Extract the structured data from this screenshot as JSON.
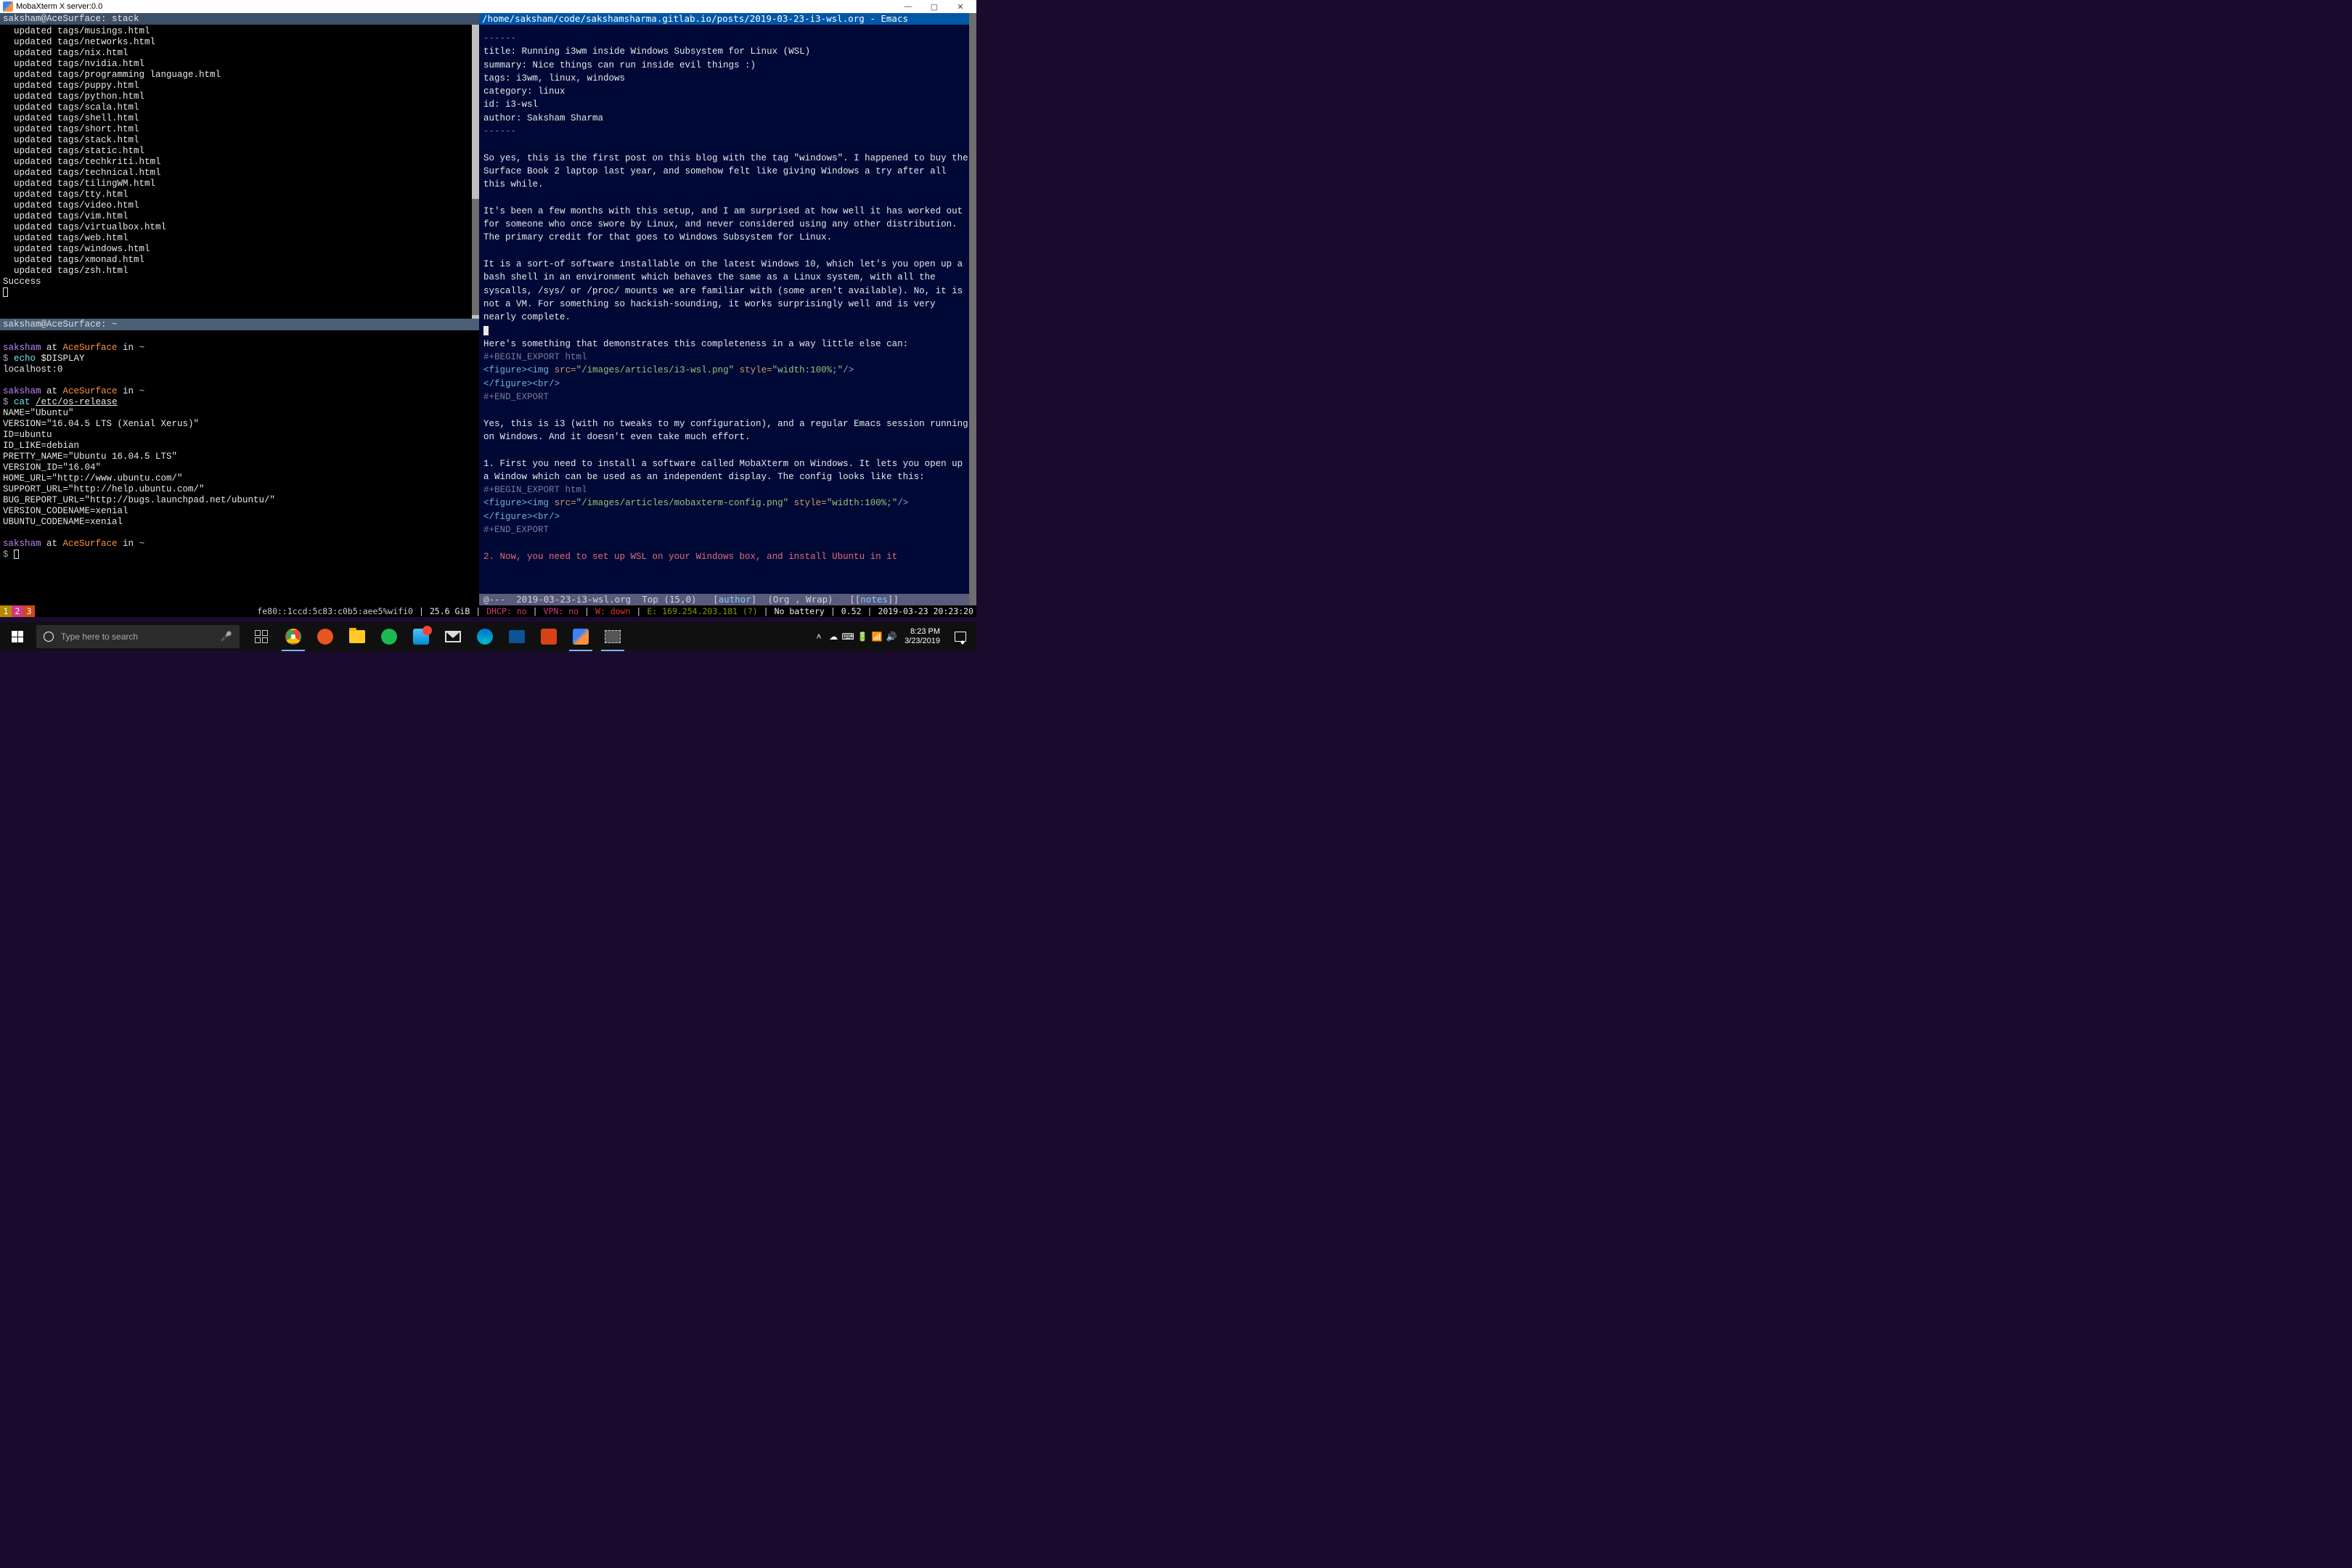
{
  "window": {
    "title": "MobaXterm X server:0.0"
  },
  "left": {
    "top_tab": "saksham@AceSurface: stack",
    "top_lines": [
      "  updated tags/musings.html",
      "  updated tags/networks.html",
      "  updated tags/nix.html",
      "  updated tags/nvidia.html",
      "  updated tags/programming language.html",
      "  updated tags/puppy.html",
      "  updated tags/python.html",
      "  updated tags/scala.html",
      "  updated tags/shell.html",
      "  updated tags/short.html",
      "  updated tags/stack.html",
      "  updated tags/static.html",
      "  updated tags/techkriti.html",
      "  updated tags/technical.html",
      "  updated tags/tilingWM.html",
      "  updated tags/tty.html",
      "  updated tags/video.html",
      "  updated tags/vim.html",
      "  updated tags/virtualbox.html",
      "  updated tags/web.html",
      "  updated tags/windows.html",
      "  updated tags/xmonad.html",
      "  updated tags/zsh.html",
      "Success"
    ],
    "bot_tab": "saksham@AceSurface: ~",
    "prompt": {
      "user": "saksham",
      "at": " at ",
      "host": "AceSurface",
      "in": " in ",
      "path": "~"
    },
    "cmd1": "echo $DISPLAY",
    "out1": "localhost:0",
    "cmd2": "cat ",
    "cmd2_arg": "/etc/os-release",
    "os_release": [
      "NAME=\"Ubuntu\"",
      "VERSION=\"16.04.5 LTS (Xenial Xerus)\"",
      "ID=ubuntu",
      "ID_LIKE=debian",
      "PRETTY_NAME=\"Ubuntu 16.04.5 LTS\"",
      "VERSION_ID=\"16.04\"",
      "HOME_URL=\"http://www.ubuntu.com/\"",
      "SUPPORT_URL=\"http://help.ubuntu.com/\"",
      "BUG_REPORT_URL=\"http://bugs.launchpad.net/ubuntu/\"",
      "VERSION_CODENAME=xenial",
      "UBUNTU_CODENAME=xenial"
    ]
  },
  "emacs": {
    "titlebar": "/home/saksham/code/sakshamsharma.gitlab.io/posts/2019-03-23-i3-wsl.org - Emacs",
    "dash": "------",
    "fm_title": "title: Running i3wm inside Windows Subsystem for Linux (WSL)",
    "fm_summary": "summary: Nice things can run inside evil things :)",
    "fm_tags": "tags: i3wm, linux, windows",
    "fm_category": "category: linux",
    "fm_id": "id: i3-wsl",
    "fm_author": "author: Saksham Sharma",
    "p1": "So yes, this is the first post on this blog with the tag \"windows\". I happened to buy the Surface Book 2 laptop last year, and somehow felt like giving Windows a try after all this while.",
    "p2": "It's been a few months with this setup, and I am surprised at how well it has worked out for someone who once swore by Linux, and never considered using any other distribution. The primary credit for that goes to Windows Subsystem for Linux.",
    "p3": "It is a sort-of software installable on the latest Windows 10, which let's you open up a bash shell in an environment which behaves the same as a Linux system, with all the syscalls, /sys/ or /proc/ mounts we are familiar with (some aren't available). No, it is not a VM. For something so hackish-sounding, it works surprisingly well and is very nearly complete.",
    "p4": "Here's something that demonstrates this completeness in a way little else can:",
    "export_begin": "#+BEGIN_EXPORT html",
    "fig1_a": "figure",
    "fig1_b": "img",
    "fig1_src": "\"/images/articles/i3-wsl.png\"",
    "fig1_style": "\"width:100%;\"",
    "br": "br",
    "export_end": "#+END_EXPORT",
    "p5": "Yes, this is i3 (with no tweaks to my configuration), and a regular Emacs session running on Windows. And it doesn't even take much effort.",
    "p6": "1. First you need to install a software called MobaXterm on Windows. It lets you open up a Window which can be used as an independent display. The config looks like this:",
    "fig2_src": "\"/images/articles/mobaxterm-config.png\"",
    "p7": "2. Now, you need to set up WSL on your Windows box, and install Ubuntu in it",
    "modeline": {
      "left": "@---  2019-03-23-i3-wsl.org  Top (15,0)   [",
      "author": "author",
      "mid": "]  (Org , Wrap)   [[",
      "notes": "notes",
      "right": "]]"
    }
  },
  "i3bar": {
    "ws": [
      "1",
      "2",
      "3"
    ],
    "net": "fe80::1ccd:5c83:c0b5:aee5%wifi0",
    "disk": "25.6 GiB",
    "dhcp": "DHCP: no",
    "vpn": "VPN: no",
    "w": "W: down",
    "e": "E: 169.254.203.181 (?)",
    "bat": "No battery",
    "load": "0.52",
    "date": "2019-03-23 20:23:20"
  },
  "taskbar": {
    "search_placeholder": "Type here to search",
    "clock_time": "8:23 PM",
    "clock_date": "3/23/2019"
  }
}
